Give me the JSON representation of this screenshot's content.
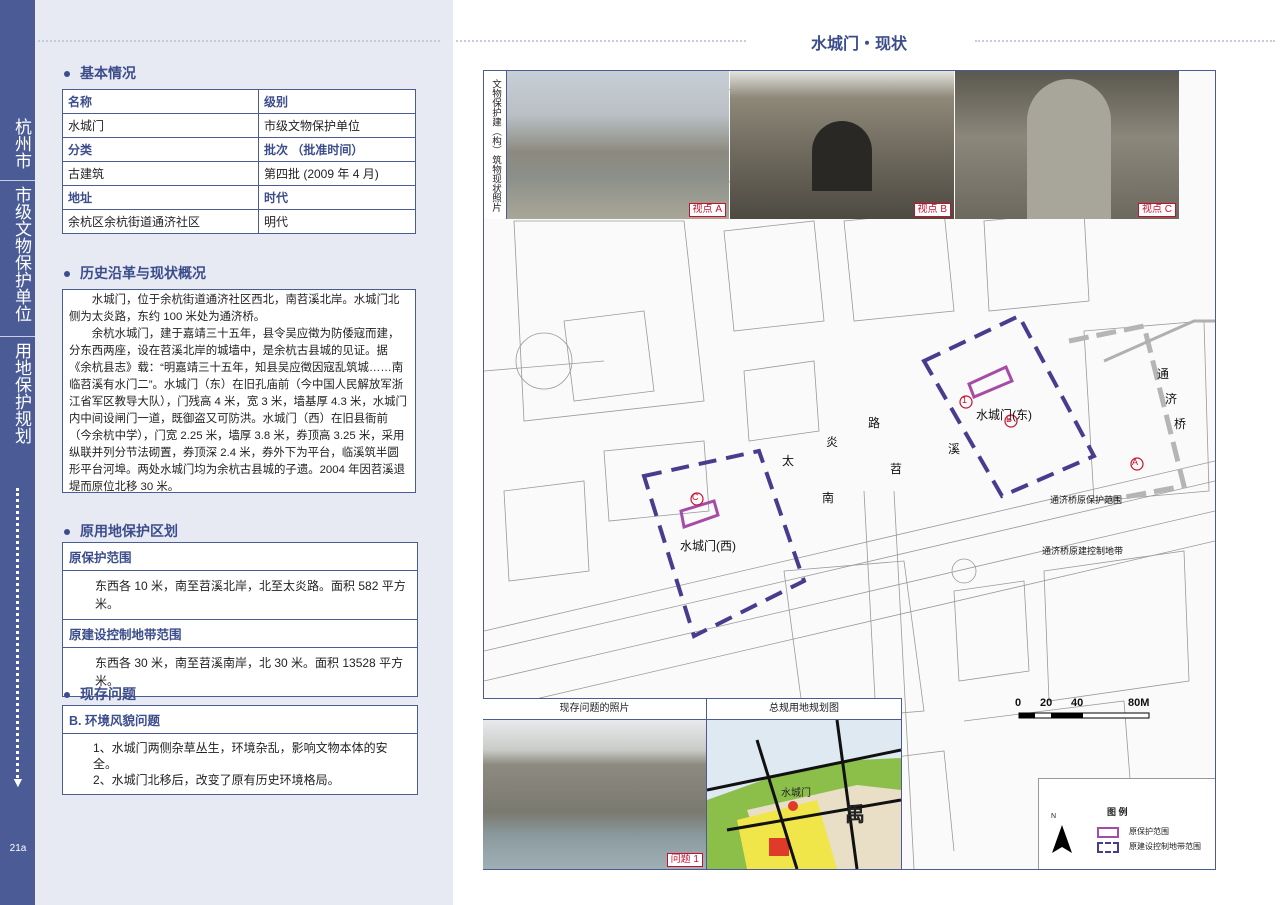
{
  "sidebar": {
    "city": "杭州市",
    "category": "市级文物保护单位",
    "topic": "用地保护规划",
    "page": "21a"
  },
  "header": {
    "title": "水城门・现状"
  },
  "basic": {
    "title": "基本情况",
    "rows": [
      [
        "名称",
        "级别"
      ],
      [
        "水城门",
        "市级文物保护单位"
      ],
      [
        "分类",
        "批次 （批准时间）"
      ],
      [
        "古建筑",
        "第四批 (2009 年 4 月)"
      ],
      [
        "地址",
        "时代"
      ],
      [
        "余杭区余杭街道通济社区",
        "明代"
      ]
    ]
  },
  "history": {
    "title": "历史沿革与现状概况",
    "p1": "水城门，位于余杭街道通济社区西北，南苕溪北岸。水城门北侧为太炎路，东约 100 米处为通济桥。",
    "p2": "余杭水城门，建于嘉靖三十五年，县令吴应徵为防倭寇而建，分东西两座，设在苕溪北岸的城墙中，是余杭古县城的见证。据《余杭县志》载：“明嘉靖三十五年，知县吴应徵因寇乱筑城……南临苕溪有水门二”。水城门（东）在旧孔庙前（今中国人民解放军浙江省军区教导大队），门残高 4 米，宽 3 米，墙基厚 4.3 米，水城门内中间设闸门一道，既御盗又可防洪。水城门（西）在旧县衙前（今余杭中学），门宽 2.25 米，墙厚 3.8 米，券顶高 3.25 米，采用纵联并列分节法砌置，券顶深 2.4 米，券外下为平台，临溪筑半圆形平台河埠。两处水城门均为余杭古县城的子遗。2004 年因苕溪退堤而原位北移 30 米。"
  },
  "protection": {
    "title": "原用地保护区划",
    "range_head": "原保护范围",
    "range_text": "东西各 10 米，南至苕溪北岸，北至太炎路。面积 582 平方米。",
    "control_head": "原建设控制地带范围",
    "control_text": "东西各 30 米，南至苕溪南岸，北 30 米。面积 13528 平方米。"
  },
  "issues": {
    "title": "现存问题",
    "head": "B. 环境风貌问题",
    "items": [
      "1、水城门两侧杂草丛生，环境杂乱，影响文物本体的安全。",
      "2、水城门北移后，改变了原有历史环境格局。"
    ]
  },
  "map": {
    "photo_caption": "文物保护建（构）筑物现状照片",
    "viewpoints": [
      "视点 A",
      "视点 B",
      "视点 C"
    ],
    "labels": {
      "east_gate": "水城门(东)",
      "west_gate": "水城门(西)",
      "road": [
        "太",
        "炎",
        "路"
      ],
      "river": [
        "南",
        "苕",
        "溪"
      ],
      "bridge": [
        "通",
        "济",
        "桥"
      ],
      "bridge_range": "通济桥原保护范围",
      "bridge_control": "通济桥原建控制地带"
    },
    "markers": [
      "A",
      "B",
      "C",
      "1"
    ],
    "scale": [
      "0",
      "20",
      "40",
      "80M"
    ],
    "issue_photo_title": "现存问题的照片",
    "issue_tag": "问题 1",
    "plan_title": "总规用地规划图",
    "plan_label": "水城门",
    "plan_char": "禹",
    "legend_title": "图  例",
    "legend_items": [
      "原保护范围",
      "原建设控制地带范围"
    ],
    "north": "N"
  },
  "colors": {
    "accent": "#4a5b95",
    "protect": "#a64ca6",
    "control": "#4b3b8f",
    "red": "#c8102e"
  }
}
